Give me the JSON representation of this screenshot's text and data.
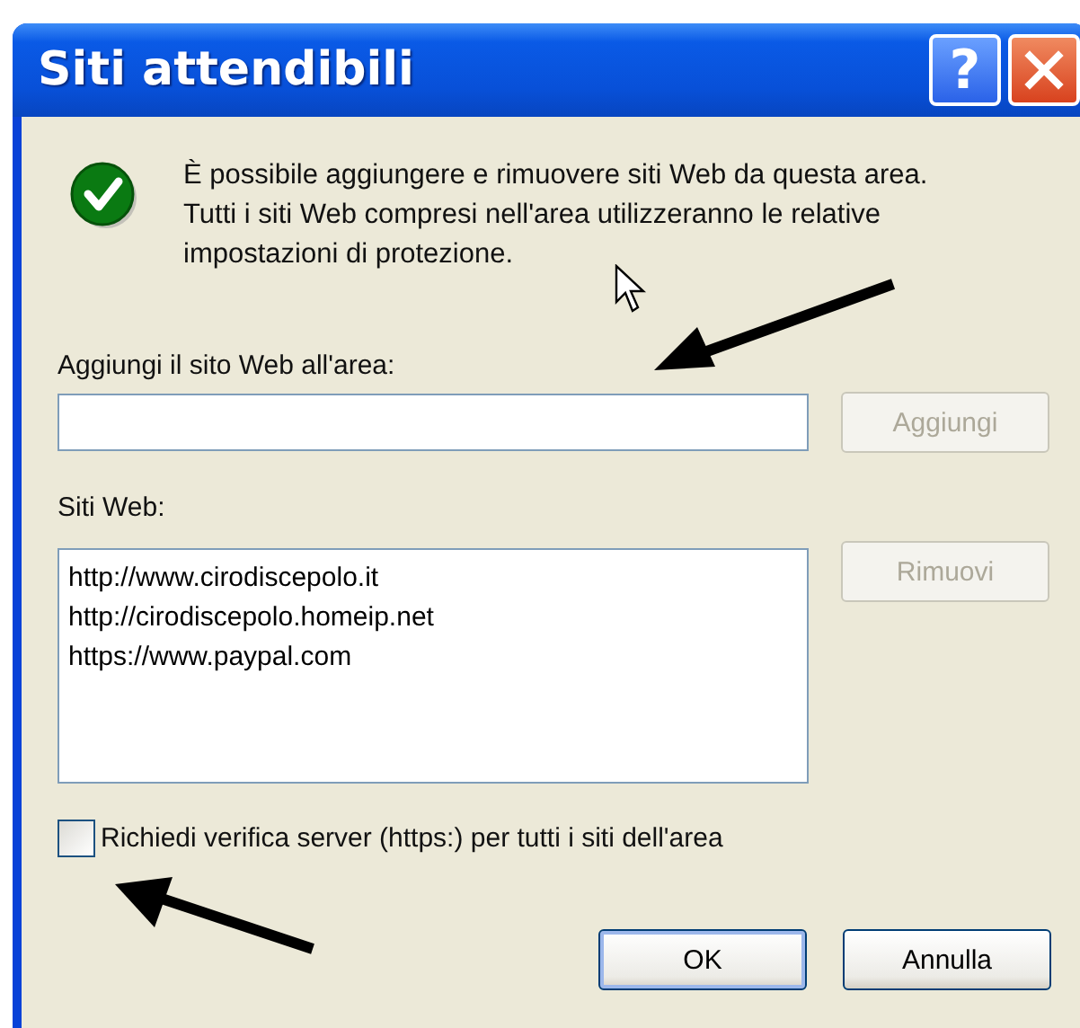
{
  "window": {
    "title": "Siti attendibili",
    "help_button": "?"
  },
  "message": "È possibile aggiungere e rimuovere siti Web da questa area. Tutti i siti Web compresi nell'area utilizzeranno le relative impostazioni di protezione.",
  "add_site": {
    "label": "Aggiungi il sito Web all'area:",
    "button": {
      "label": "Aggiungi",
      "disabled": true
    }
  },
  "sites": {
    "label": "Siti Web:",
    "items": [
      {
        "text": "http://www.cirodiscepolo.it",
        "selected": false
      },
      {
        "text": "http://cirodiscepolo.homeip.net",
        "selected": false
      },
      {
        "text": "https://www.paypal.com",
        "selected": false
      }
    ],
    "button": {
      "label": "Rimuovi",
      "disabled": true
    }
  },
  "require_https": {
    "label": "Richiedi verifica server (https:) per tutti i siti dell'area",
    "checked": false
  },
  "buttons": [
    {
      "label": "OK",
      "default": true
    },
    {
      "label": "Annulla",
      "default": false
    }
  ]
}
